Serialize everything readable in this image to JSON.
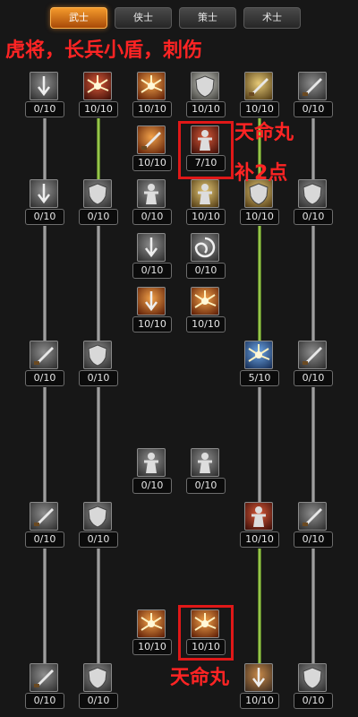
{
  "tabs": [
    "武士",
    "侠士",
    "策士",
    "术士"
  ],
  "active_tab": 0,
  "annotations": {
    "top_note": "虎将，长兵小盾，刺伤",
    "pill_label_1": "天命丸",
    "add_points": "补2点",
    "pill_label_2": "天命丸"
  },
  "skills": [
    {
      "counter": "0/10",
      "icon": "arrow-down-icon",
      "style": "gray"
    },
    {
      "counter": "10/10",
      "icon": "slash-burst-icon",
      "style": "red"
    },
    {
      "counter": "10/10",
      "icon": "fire-burst-icon",
      "style": "fire"
    },
    {
      "counter": "10/10",
      "icon": "white-shield-icon",
      "style": "pale"
    },
    {
      "counter": "10/10",
      "icon": "golden-spear-icon",
      "style": "gold"
    },
    {
      "counter": "0/10",
      "icon": "axe-icon",
      "style": "gray"
    },
    {
      "counter": "10/10",
      "icon": "sword-slash-icon",
      "style": "fire"
    },
    {
      "counter": "7/10",
      "icon": "demon-warrior-icon",
      "style": "red"
    },
    {
      "counter": "0/10",
      "icon": "blade-strike-icon",
      "style": "gray"
    },
    {
      "counter": "0/10",
      "icon": "shield-icon",
      "style": "gray"
    },
    {
      "counter": "0/10",
      "icon": "warrior-icon",
      "style": "gray"
    },
    {
      "counter": "10/10",
      "icon": "warrior-glow-icon",
      "style": "gold"
    },
    {
      "counter": "10/10",
      "icon": "golden-shield-icon",
      "style": "gold"
    },
    {
      "counter": "0/10",
      "icon": "armor-icon",
      "style": "gray"
    },
    {
      "counter": "0/10",
      "icon": "strike-icon",
      "style": "gray"
    },
    {
      "counter": "0/10",
      "icon": "fist-icon",
      "style": "gray"
    },
    {
      "counter": "10/10",
      "icon": "flame-strike-icon",
      "style": "fire"
    },
    {
      "counter": "10/10",
      "icon": "fire-ring-icon",
      "style": "fire"
    },
    {
      "counter": "0/10",
      "icon": "blade-swing-icon",
      "style": "gray"
    },
    {
      "counter": "0/10",
      "icon": "armored-warrior-icon",
      "style": "gray"
    },
    {
      "counter": "5/10",
      "icon": "lightning-warrior-icon",
      "style": "blue"
    },
    {
      "counter": "0/10",
      "icon": "crossed-blades-icon",
      "style": "gray"
    },
    {
      "counter": "0/10",
      "icon": "figure-icon",
      "style": "gray"
    },
    {
      "counter": "0/10",
      "icon": "figure-stance-icon",
      "style": "gray"
    },
    {
      "counter": "0/10",
      "icon": "curved-blade-icon",
      "style": "gray"
    },
    {
      "counter": "0/10",
      "icon": "spiral-shield-icon",
      "style": "gray"
    },
    {
      "counter": "10/10",
      "icon": "red-warrior-icon",
      "style": "red"
    },
    {
      "counter": "0/10",
      "icon": "crescent-icon",
      "style": "gray"
    },
    {
      "counter": "10/10",
      "icon": "fire-whirl-icon",
      "style": "fire"
    },
    {
      "counter": "10/10",
      "icon": "flame-figure-icon",
      "style": "fire"
    },
    {
      "counter": "0/10",
      "icon": "sword-shield-icon",
      "style": "gray"
    },
    {
      "counter": "0/10",
      "icon": "dark-shield-icon",
      "style": "gray"
    },
    {
      "counter": "10/10",
      "icon": "golden-dash-icon",
      "style": "mixed"
    },
    {
      "counter": "0/10",
      "icon": "spiral-emblem-icon",
      "style": "gray"
    }
  ]
}
